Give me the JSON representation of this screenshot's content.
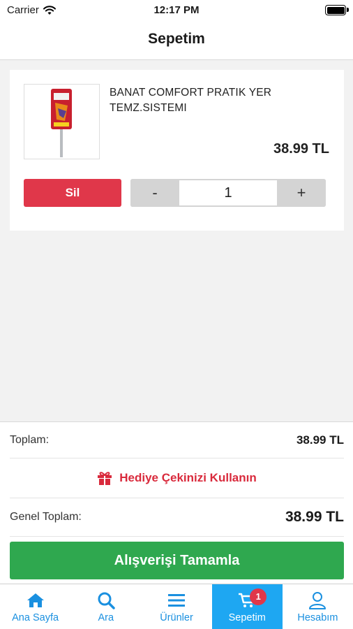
{
  "status_bar": {
    "carrier": "Carrier",
    "time": "12:17 PM",
    "icons": [
      "wifi-icon",
      "battery-icon"
    ]
  },
  "nav": {
    "title": "Sepetim"
  },
  "cart": {
    "items": [
      {
        "name": "BANAT COMFORT PRATIK YER TEMZ.SISTEMI",
        "price": "38.99 TL",
        "quantity": "1",
        "delete_label": "Sil",
        "decrement_label": "-",
        "increment_label": "+"
      }
    ]
  },
  "summary": {
    "subtotal_label": "Toplam:",
    "subtotal_value": "38.99 TL",
    "gift_label": "Hediye Çekinizi Kullanın",
    "grand_total_label": "Genel Toplam:",
    "grand_total_value": "38.99 TL",
    "checkout_label": "Alışverişi Tamamla"
  },
  "tabs": [
    {
      "label": "Ana Sayfa",
      "icon": "home-icon"
    },
    {
      "label": "Ara",
      "icon": "search-icon"
    },
    {
      "label": "Ürünler",
      "icon": "menu-icon"
    },
    {
      "label": "Sepetim",
      "icon": "cart-icon",
      "badge": "1",
      "active": true
    },
    {
      "label": "Hesabım",
      "icon": "user-icon"
    }
  ],
  "colors": {
    "accent": "#1ea7f2",
    "danger": "#e0374a",
    "success": "#2fa84f",
    "gift": "#d92a3c"
  }
}
